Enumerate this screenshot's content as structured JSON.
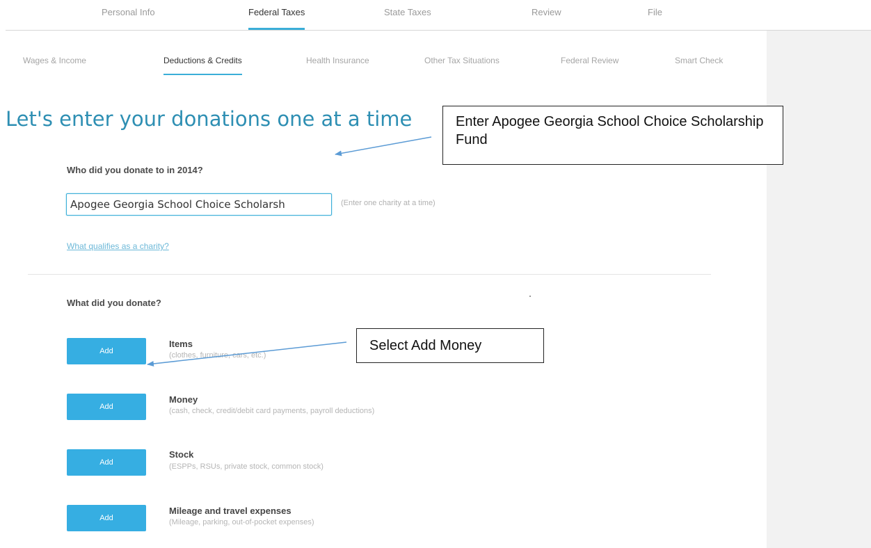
{
  "top_tabs": [
    "Personal Info",
    "Federal Taxes",
    "State Taxes",
    "Review",
    "File"
  ],
  "sub_tabs": [
    "Wages & Income",
    "Deductions & Credits",
    "Health Insurance",
    "Other Tax Situations",
    "Federal Review",
    "Smart Check"
  ],
  "heading": "Let's enter your donations one at a time",
  "form": {
    "question": "Who did you donate to in 2014?",
    "charity_value": "Apogee Georgia School Choice Scholarsh",
    "charity_hint": "(Enter one charity at a time)",
    "qualifies_link": "What qualifies as a charity?",
    "donate_question": "What did you donate?"
  },
  "options": [
    {
      "button": "Add",
      "title": "Items",
      "subtitle": "(clothes, furniture, cars, etc.)"
    },
    {
      "button": "Add",
      "title": "Money",
      "subtitle": "(cash, check, credit/debit card payments, payroll deductions)"
    },
    {
      "button": "Add",
      "title": "Stock",
      "subtitle": "(ESPPs, RSUs, private stock, common stock)"
    },
    {
      "button": "Add",
      "title": "Mileage and travel expenses",
      "subtitle": "(Mileage, parking, out-of-pocket expenses)"
    }
  ],
  "annotations": {
    "callout_1": "Enter Apogee Georgia School Choice Scholarship Fund",
    "callout_2": "Select Add Money"
  },
  "colors": {
    "accent": "#3aaed8",
    "button": "#36aee2",
    "heading": "#2e8fb3",
    "arrow": "#5b9bd5"
  }
}
